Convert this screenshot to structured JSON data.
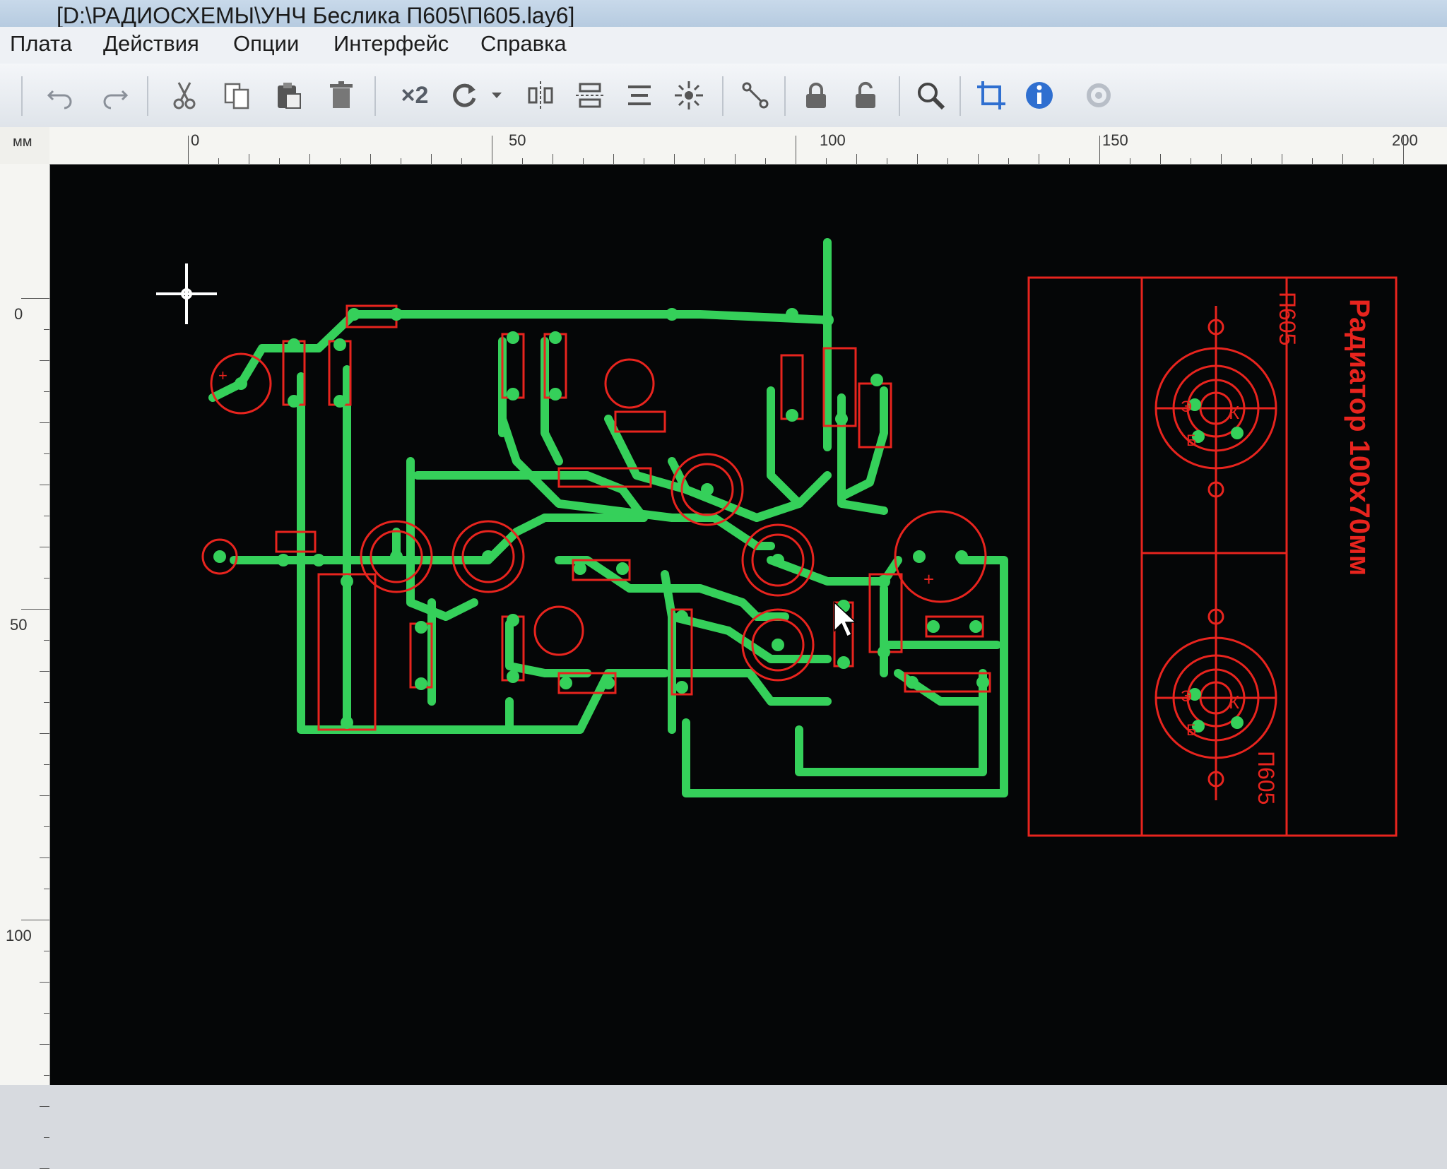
{
  "window": {
    "title": "[D:\\РАДИОСХЕМЫ\\УНЧ Беслика П605\\П605.lay6]"
  },
  "menu": {
    "items": [
      "Плата",
      "Действия",
      "Опции",
      "Интерфейс",
      "Справка"
    ]
  },
  "toolbar": {
    "zoom_x2_label": "×2",
    "icons": [
      "undo-icon",
      "redo-icon",
      "cut-icon",
      "copy-icon",
      "paste-icon",
      "delete-icon",
      "zoom-x2-icon",
      "rotate-icon",
      "rotate-dropdown-icon",
      "mirror-h-icon",
      "mirror-v-icon",
      "align-icon",
      "group-icon",
      "ungroup-icon",
      "connections-icon",
      "lock-icon",
      "unlock-icon",
      "search-icon",
      "crop-icon",
      "info-icon",
      "settings-icon"
    ]
  },
  "rulers": {
    "unit": "мм",
    "top_labels": [
      "0",
      "50",
      "100",
      "150",
      "200"
    ],
    "left_labels": [
      "0",
      "50",
      "100"
    ]
  },
  "board": {
    "radiator_label": "Радиатор 100х70мм",
    "transistor_label_top": "П605",
    "transistor_label_bottom": "П605",
    "collector_mark": "К",
    "emitter_mark": "Э",
    "base_mark": "Б",
    "polarity_mark": "+"
  },
  "colors": {
    "track": "#35d05a",
    "silk": "#e8241e",
    "canvas_bg": "#050607"
  }
}
